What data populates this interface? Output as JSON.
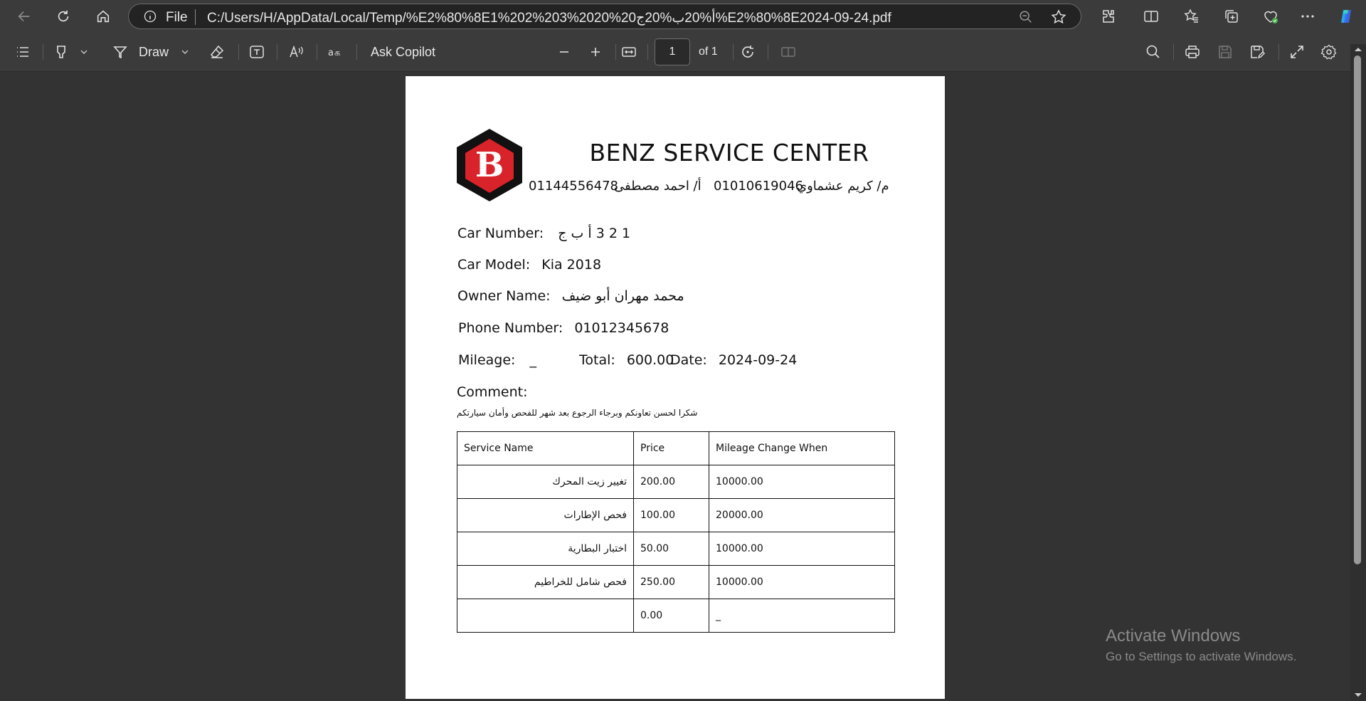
{
  "browser": {
    "address": {
      "scheme_label": "File",
      "url": "C:/Users/H/AppData/Local/Temp/%E2%80%8E1%202%203%2020%20أ%20ب%20ج%E2%80%8E2024-09-24.pdf"
    },
    "icons": [
      "back-icon",
      "refresh-icon",
      "home-icon",
      "info-icon",
      "zoom-out-icon",
      "favorite-star-icon",
      "extensions-icon",
      "split-screen-icon",
      "favorites-icon",
      "collections-icon",
      "browser-essentials-icon",
      "more-icon",
      "copilot-icon"
    ]
  },
  "pdf_toolbar": {
    "draw_label": "Draw",
    "ask_copilot_label": "Ask Copilot",
    "current_page": "1",
    "page_of": "of 1"
  },
  "document": {
    "logo_letter": "B",
    "title": "BENZ SERVICE CENTER",
    "contact_1_name": "م/ كريم عشماوي",
    "contact_1_phone": "01010619046",
    "contact_2_name": "أ/ احمد مصطفى",
    "contact_2_phone": "01144556478",
    "car_number_label": "Car Number:",
    "car_number_value": "1 2 3 أ ب ج",
    "car_model_label": "Car Model:",
    "car_model_value": "Kia 2018",
    "owner_label": "Owner Name:",
    "owner_value": "محمد مهران أبو ضيف",
    "phone_label": "Phone Number:",
    "phone_value": "01012345678",
    "mileage_label": "Mileage:",
    "mileage_value": "_",
    "total_label": "Total:",
    "total_value": "600.00",
    "date_label": "Date:",
    "date_value": "2024-09-24",
    "comment_label": "Comment:",
    "comment_note": "شكرا لحسن تعاونكم وبرجاء الرجوع بعد شهر للفحص وأمان سيارتكم",
    "table": {
      "headers": [
        "Service Name",
        "Price",
        "Mileage Change When"
      ],
      "rows": [
        [
          "تغيير زيت المحرك",
          "200.00",
          "10000.00"
        ],
        [
          "فحص الإطارات",
          "100.00",
          "20000.00"
        ],
        [
          "اختبار البطارية",
          "50.00",
          "10000.00"
        ],
        [
          "فحص شامل للخراطيم",
          "250.00",
          "10000.00"
        ],
        [
          "",
          "0.00",
          "_"
        ]
      ]
    }
  },
  "watermark": {
    "title": "Activate Windows",
    "subtitle": "Go to Settings to activate Windows."
  },
  "colors": {
    "logo_red": "#d9232a",
    "logo_black": "#111111",
    "chrome_bg": "#3b3b3b",
    "viewer_bg": "#333333"
  }
}
